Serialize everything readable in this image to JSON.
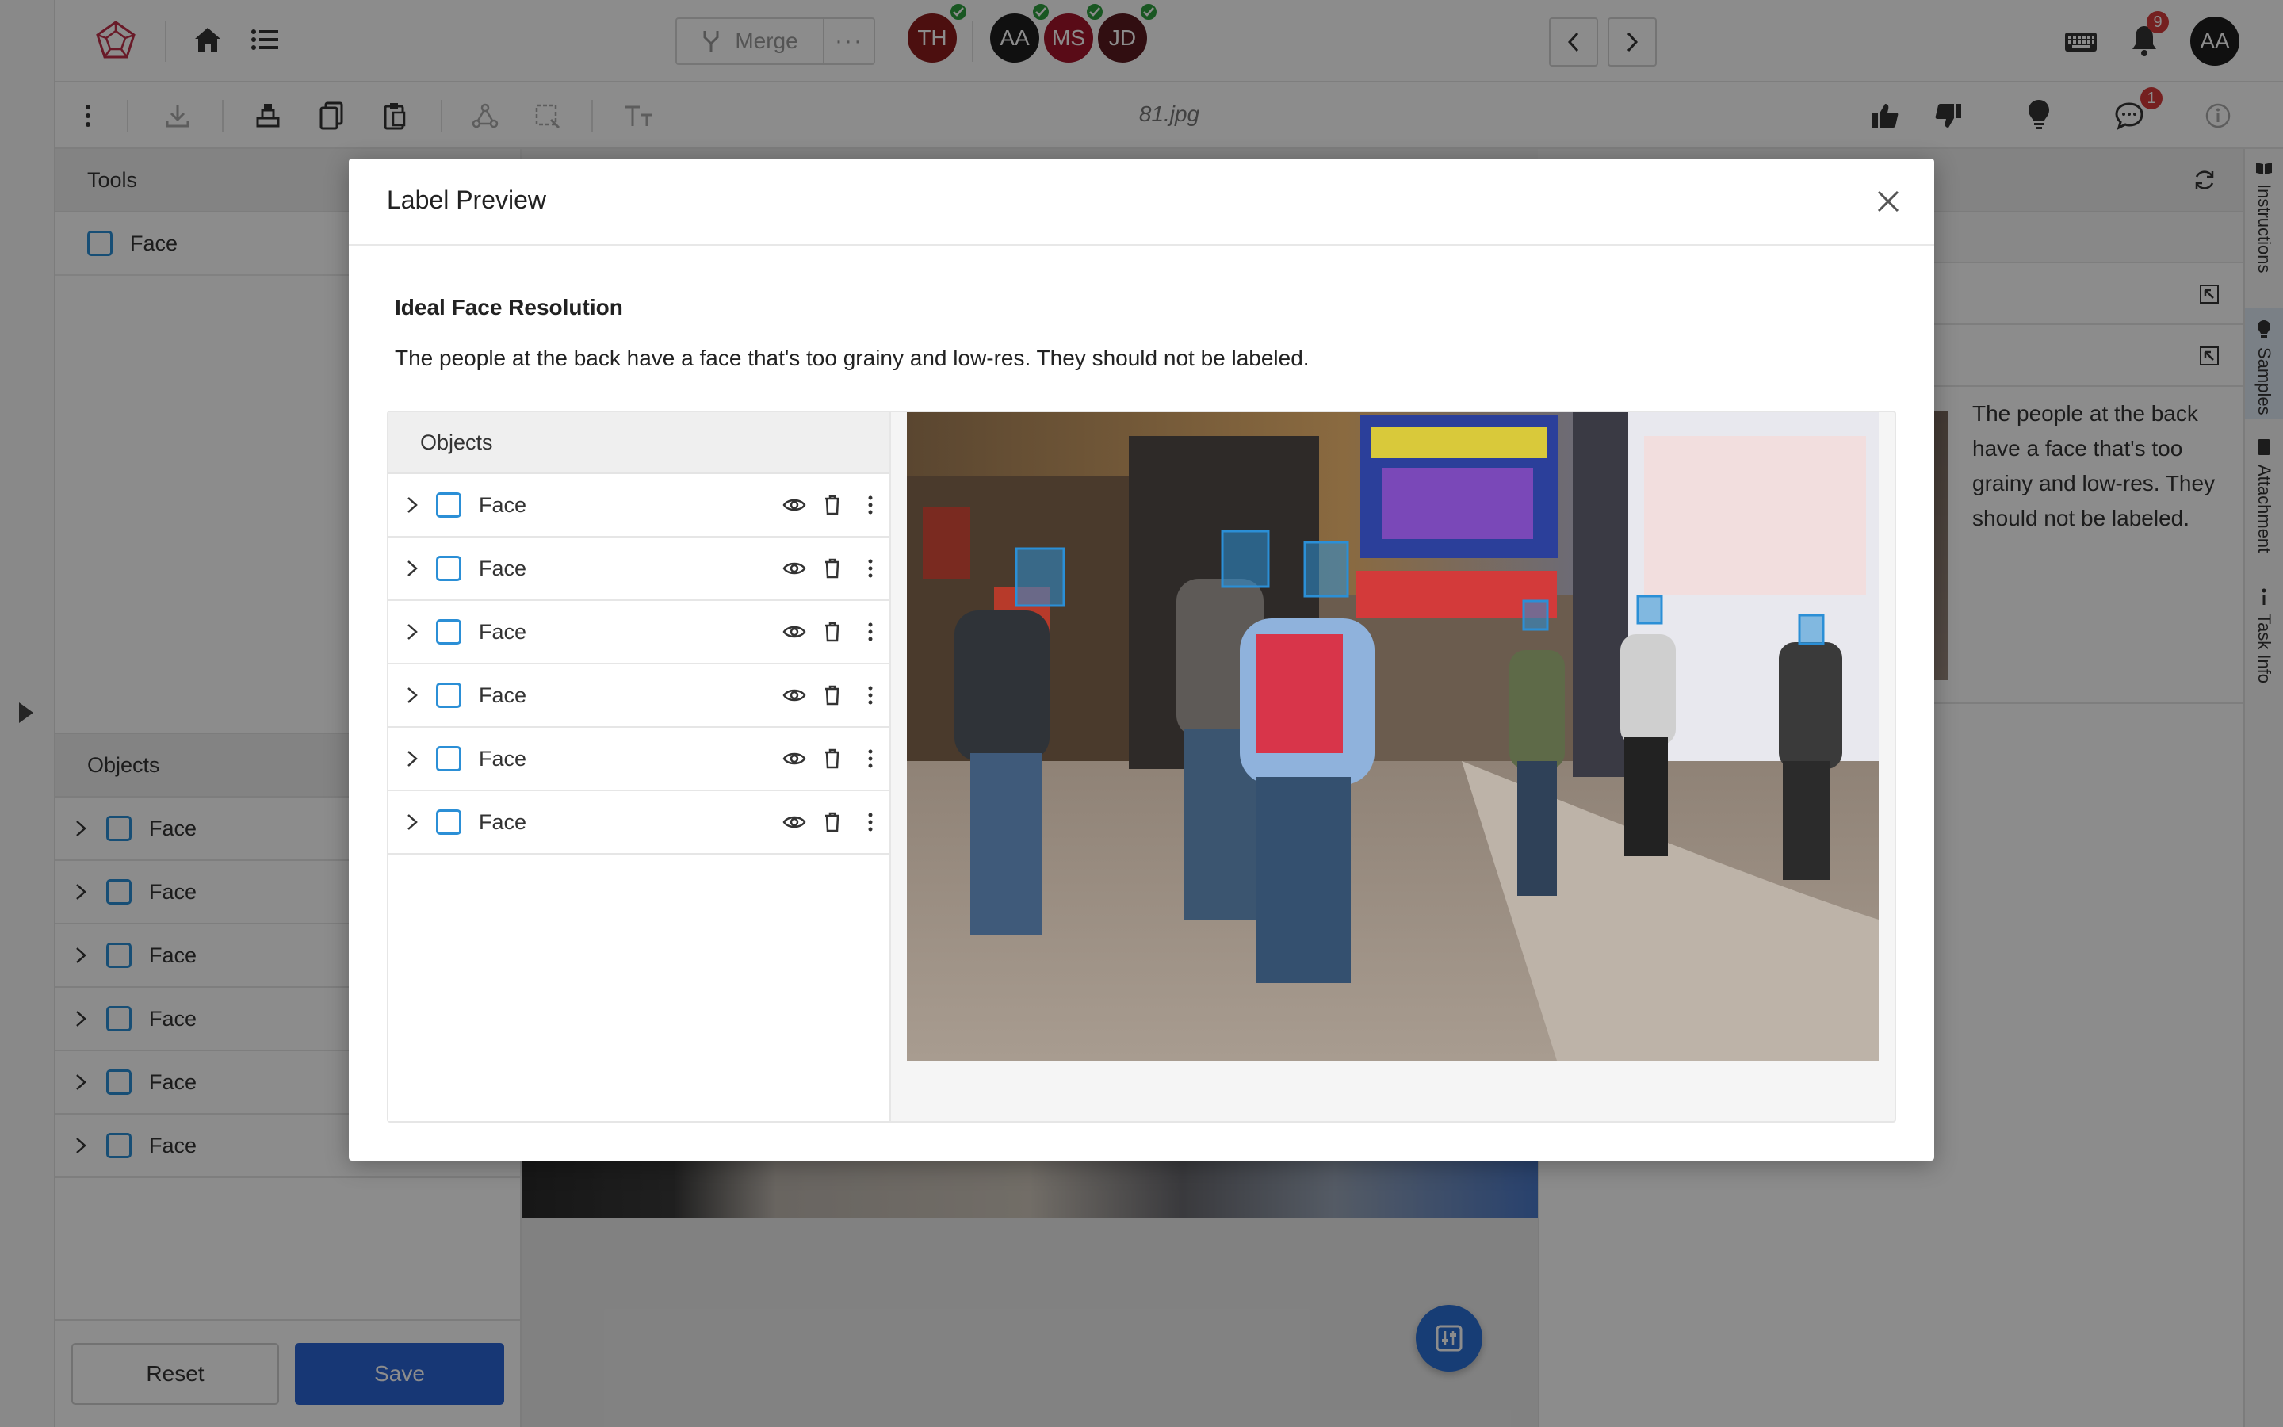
{
  "topbar": {
    "merge_label": "Merge",
    "merge_more": "···",
    "collaborators": [
      {
        "initials": "TH",
        "color": "#8b1c1c",
        "verified": true
      },
      {
        "initials": "AA",
        "color": "#1e1e1e",
        "verified": true
      },
      {
        "initials": "MS",
        "color": "#a3142a",
        "verified": true
      },
      {
        "initials": "JD",
        "color": "#5a1a1f",
        "verified": true
      }
    ],
    "notifications_count": "9",
    "user_initials": "AA"
  },
  "toolbar": {
    "filename": "81.jpg",
    "comments_count": "1"
  },
  "tools_panel": {
    "title": "Tools",
    "items": [
      {
        "label": "Face"
      }
    ]
  },
  "objects_panel": {
    "title": "Objects",
    "items": [
      {
        "label": "Face"
      },
      {
        "label": "Face"
      },
      {
        "label": "Face"
      },
      {
        "label": "Face"
      },
      {
        "label": "Face"
      },
      {
        "label": "Face"
      }
    ]
  },
  "footer": {
    "reset_label": "Reset",
    "save_label": "Save"
  },
  "right_panel": {
    "sample_text": "The people at the back have a face that's too grainy and low-res. They should not be labeled."
  },
  "side_tabs": [
    {
      "label": "Instructions"
    },
    {
      "label": "Samples"
    },
    {
      "label": "Attachment"
    },
    {
      "label": "Task Info"
    }
  ],
  "modal": {
    "title": "Label Preview",
    "section_title": "Ideal Face Resolution",
    "description": "The people at the back have a face that's too grainy and low-res. They should not be labeled.",
    "objects_title": "Objects",
    "objects": [
      {
        "label": "Face"
      },
      {
        "label": "Face"
      },
      {
        "label": "Face"
      },
      {
        "label": "Face"
      },
      {
        "label": "Face"
      },
      {
        "label": "Face"
      }
    ]
  },
  "colors": {
    "accent": "#2b8fd6",
    "primary_button": "#2a64d6",
    "badge": "#d63b3b",
    "verified": "#2e9e3e"
  },
  "icons": {
    "app_logo": "dodecahedron-icon",
    "home": "home-icon",
    "list": "list-icon",
    "keyboard": "keyboard-icon",
    "bell": "bell-icon",
    "thumbs_up": "thumbs-up-icon",
    "thumbs_down": "thumbs-down-icon",
    "lightbulb": "lightbulb-icon",
    "comment": "comment-icon",
    "info": "info-icon",
    "eye": "eye-icon",
    "trash": "trash-icon",
    "more": "more-vertical-icon"
  }
}
